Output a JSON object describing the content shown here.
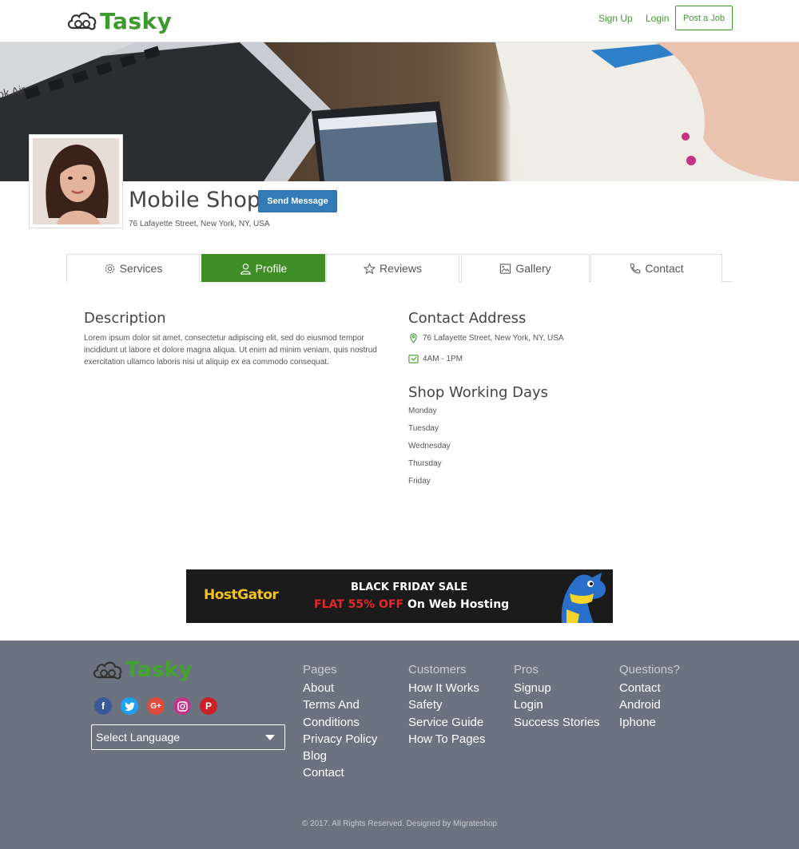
{
  "header": {
    "logo_text": "Tasky",
    "sign_up": "Sign Up",
    "login": "Login",
    "post_job": "Post a Job"
  },
  "profile": {
    "name": "Mobile Shop",
    "send_message": "Send Message",
    "address": "76 Lafayette Street, New York, NY, USA"
  },
  "tabs": [
    {
      "label": "Services",
      "icon": "gear-icon"
    },
    {
      "label": "Profile",
      "icon": "user-icon"
    },
    {
      "label": "Reviews",
      "icon": "star-icon"
    },
    {
      "label": "Gallery",
      "icon": "image-icon"
    },
    {
      "label": "Contact",
      "icon": "phone-icon"
    }
  ],
  "description": {
    "title": "Description",
    "text": "Lorem ipsum dolor sit amet, consectetur adipiscing elit, sed do eiusmod tempor incididunt ut labore et dolore magna aliqua. Ut enim ad minim veniam, quis nostrud exercitation ullamco laboris nisi ut aliquip ex ea commodo consequat."
  },
  "contact": {
    "title": "Contact Address",
    "address": "76 Lafayette Street, New York, NY, USA",
    "hours": "4AM - 1PM"
  },
  "working_days": {
    "title": "Shop Working Days",
    "days": [
      "Monday",
      "Tuesday",
      "Wednesday",
      "Thursday",
      "Friday"
    ]
  },
  "ad": {
    "brand": "HostGator",
    "line1": "BLACK FRIDAY SALE",
    "line2_highlight": "FLAT 55% OFF",
    "line2_rest": "On Web Hosting"
  },
  "footer": {
    "logo_text": "Tasky",
    "language": "Select Language",
    "columns": [
      {
        "heading": "Pages",
        "items": [
          "About",
          "Terms And",
          "Conditions",
          "Privacy Policy",
          "Blog",
          "Contact"
        ]
      },
      {
        "heading": "Customers",
        "items": [
          "How It Works",
          "Safety",
          "Service Guide",
          "How To Pages"
        ]
      },
      {
        "heading": "Pros",
        "items": [
          "Signup",
          "Login",
          "Success Stories"
        ]
      },
      {
        "heading": "Questions?",
        "items": [
          "Contact",
          "Android",
          "Iphone"
        ]
      }
    ],
    "copyright": "© 2017. All Rights Reserved. Designed by Migrateshop"
  },
  "colors": {
    "brand_green": "#3e9a2e",
    "send_blue": "#337ab7",
    "footer_bg": "#6b7280"
  }
}
